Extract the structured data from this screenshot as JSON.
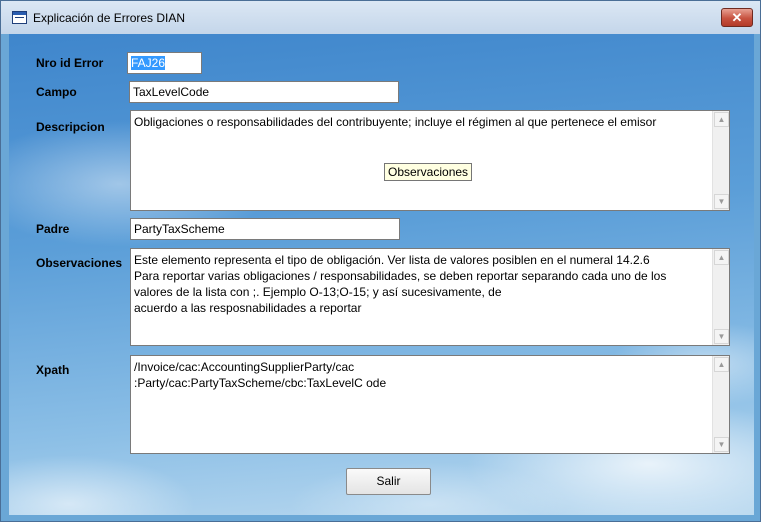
{
  "window": {
    "title": "Explicación de Errores DIAN",
    "close_label": "✕"
  },
  "form": {
    "nro_id_error": {
      "label": "Nro id Error",
      "value": "FAJ26"
    },
    "campo": {
      "label": "Campo",
      "value": "TaxLevelCode"
    },
    "descripcion": {
      "label": "Descripcion",
      "lines": [
        "Obligaciones o responsabilidades del contribuyente; incluye el régimen al que pertenece el emisor"
      ]
    },
    "tooltip": "Observaciones",
    "padre": {
      "label": "Padre",
      "value": "PartyTaxScheme"
    },
    "observaciones": {
      "label": "Observaciones",
      "lines": [
        "Este elemento representa el tipo de obligación. Ver lista de valores posiblen en el numeral 14.2.6",
        "Para reportar varias obligaciones / responsabilidades, se deben reportar separando cada uno de los",
        "valores de la lista con ;. Ejemplo O-13;O-15; y así sucesivamente, de",
        "acuerdo a las resposnabilidades a reportar"
      ]
    },
    "xpath": {
      "label": "Xpath",
      "lines": [
        "/Invoice/cac:AccountingSupplierParty/cac",
        ":Party/cac:PartyTaxScheme/cbc:TaxLevelC ode"
      ]
    }
  },
  "buttons": {
    "salir": "Salir"
  },
  "icons": {
    "scroll_up": "▲",
    "scroll_down": "▼"
  }
}
